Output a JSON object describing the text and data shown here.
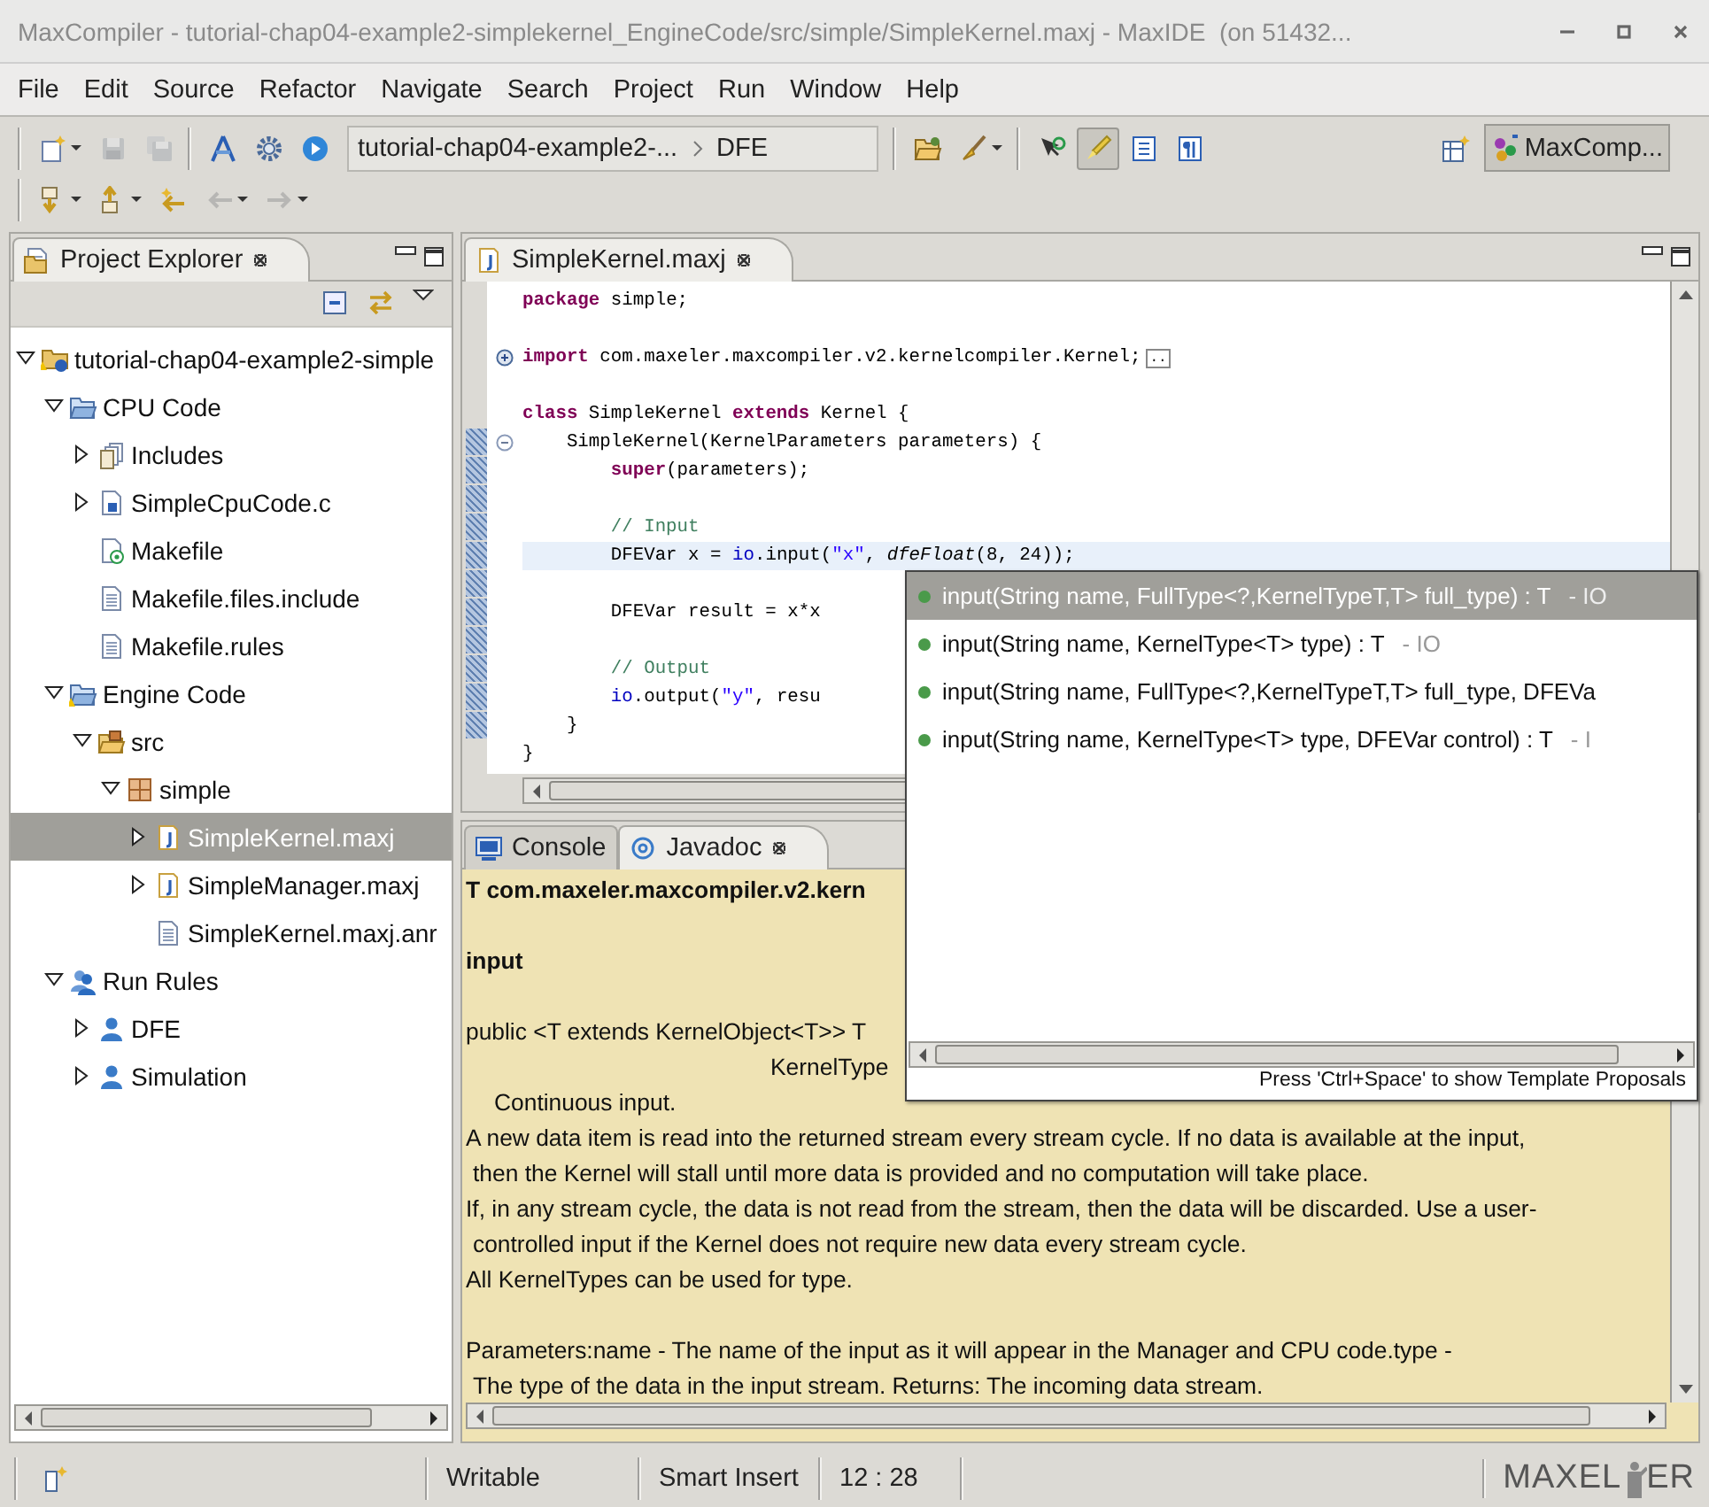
{
  "window": {
    "title": "MaxCompiler - tutorial-chap04-example2-simplekernel_EngineCode/src/simple/SimpleKernel.maxj - MaxIDE  (on 51432..."
  },
  "menu": [
    "File",
    "Edit",
    "Source",
    "Refactor",
    "Navigate",
    "Search",
    "Project",
    "Run",
    "Window",
    "Help"
  ],
  "toolbar": {
    "groups": [
      [
        {
          "kind": "new",
          "dropdown": true,
          "pressed": false,
          "disabled": false
        },
        {
          "kind": "save",
          "dropdown": false,
          "pressed": false,
          "disabled": true
        },
        {
          "kind": "save-all",
          "dropdown": false,
          "pressed": false,
          "disabled": true
        }
      ],
      [
        {
          "kind": "compass",
          "dropdown": false,
          "pressed": false,
          "disabled": false
        },
        {
          "kind": "gear",
          "dropdown": false,
          "pressed": false,
          "disabled": false
        },
        {
          "kind": "run",
          "dropdown": false,
          "pressed": false,
          "disabled": false
        }
      ]
    ],
    "breadcrumb": [
      "tutorial-chap04-example2-...",
      "DFE"
    ],
    "tool_groups": [
      [
        {
          "kind": "open-folder",
          "dropdown": false,
          "pressed": false,
          "disabled": false
        },
        {
          "kind": "brush",
          "dropdown": true,
          "pressed": false,
          "disabled": false
        }
      ],
      [
        {
          "kind": "cursor",
          "dropdown": false,
          "pressed": false,
          "disabled": false
        },
        {
          "kind": "highlighter",
          "dropdown": false,
          "pressed": true,
          "disabled": false
        },
        {
          "kind": "block",
          "dropdown": false,
          "pressed": false,
          "disabled": false
        },
        {
          "kind": "paragraph",
          "dropdown": false,
          "pressed": false,
          "disabled": false
        }
      ]
    ],
    "nav_group": [
      {
        "kind": "next-annotation",
        "dropdown": true,
        "pressed": false,
        "disabled": false
      },
      {
        "kind": "previous-annotation",
        "dropdown": true,
        "pressed": false,
        "disabled": false
      },
      {
        "kind": "last-edit",
        "dropdown": false,
        "pressed": false,
        "disabled": false
      },
      {
        "kind": "back",
        "dropdown": true,
        "pressed": false,
        "disabled": true
      },
      {
        "kind": "forward",
        "dropdown": true,
        "pressed": false,
        "disabled": true
      }
    ],
    "perspective": {
      "label": "MaxComp...",
      "selected": true
    }
  },
  "explorer": {
    "tabs": [
      {
        "label": "Project Explorer",
        "selected": true
      }
    ],
    "tree": [
      {
        "label": "tutorial-chap04-example2-simple",
        "kind": "project",
        "expanded": true,
        "selected": false,
        "children": [
          {
            "label": "CPU Code",
            "kind": "c-folder",
            "expanded": true,
            "selected": false,
            "children": [
              {
                "label": "Includes",
                "kind": "includes",
                "expanded": false,
                "selected": false
              },
              {
                "label": "SimpleCpuCode.c",
                "kind": "c-file",
                "expanded": false,
                "selected": false
              },
              {
                "label": "Makefile",
                "kind": "makefile",
                "selected": false
              },
              {
                "label": "Makefile.files.include",
                "kind": "text-file",
                "selected": false
              },
              {
                "label": "Makefile.rules",
                "kind": "text-file",
                "selected": false
              }
            ]
          },
          {
            "label": "Engine Code",
            "kind": "java-folder",
            "expanded": true,
            "selected": false,
            "children": [
              {
                "label": "src",
                "kind": "src-folder",
                "expanded": true,
                "selected": false,
                "children": [
                  {
                    "label": "simple",
                    "kind": "package",
                    "expanded": true,
                    "selected": false,
                    "children": [
                      {
                        "label": "SimpleKernel.maxj",
                        "kind": "java-file",
                        "expanded": false,
                        "selected": true
                      },
                      {
                        "label": "SimpleManager.maxj",
                        "kind": "java-file",
                        "expanded": false,
                        "selected": false
                      },
                      {
                        "label": "SimpleKernel.maxj.anr",
                        "kind": "text-file",
                        "selected": false
                      }
                    ]
                  }
                ]
              }
            ]
          },
          {
            "label": "Run Rules",
            "kind": "run-rules",
            "expanded": true,
            "selected": false,
            "children": [
              {
                "label": "DFE",
                "kind": "user",
                "expanded": false,
                "selected": false
              },
              {
                "label": "Simulation",
                "kind": "user",
                "expanded": false,
                "selected": false
              }
            ]
          }
        ]
      }
    ]
  },
  "editor": {
    "tabs": [
      {
        "label": "SimpleKernel.maxj",
        "selected": true
      }
    ],
    "lines": [
      {
        "tokens": [
          {
            "kind": "keyword",
            "text": "package"
          },
          {
            "kind": "plain",
            "text": " simple;"
          }
        ],
        "current": false,
        "changed": false
      },
      {
        "changed": false
      },
      {
        "tokens": [
          {
            "kind": "keyword",
            "text": "import"
          },
          {
            "kind": "plain",
            "text": " com.maxeler.maxcompiler.v2.kernelcompiler.Kernel;"
          },
          {
            "kind": "folded",
            "text": ".."
          }
        ],
        "collapsed": true,
        "current": false,
        "changed": false
      },
      {
        "changed": false
      },
      {
        "tokens": [
          {
            "kind": "keyword",
            "text": "class"
          },
          {
            "kind": "plain",
            "text": " SimpleKernel "
          },
          {
            "kind": "keyword",
            "text": "extends"
          },
          {
            "kind": "plain",
            "text": " Kernel {"
          }
        ],
        "current": false,
        "changed": false
      },
      {
        "tokens": [
          {
            "kind": "plain",
            "text": "    SimpleKernel(KernelParameters parameters) {"
          }
        ],
        "collapsed": false,
        "current": false,
        "changed": true
      },
      {
        "tokens": [
          {
            "kind": "keyword",
            "text": "        super"
          },
          {
            "kind": "plain",
            "text": "(parameters);"
          }
        ],
        "current": false,
        "changed": true
      },
      {
        "changed": true
      },
      {
        "tokens": [
          {
            "kind": "comment",
            "text": "        // Input"
          }
        ],
        "current": false,
        "changed": true
      },
      {
        "tokens": [
          {
            "kind": "plain",
            "text": "        DFEVar x = "
          },
          {
            "kind": "field",
            "text": "io"
          },
          {
            "kind": "plain",
            "text": ".input("
          },
          {
            "kind": "string",
            "text": "\"x\""
          },
          {
            "kind": "plain",
            "text": ", "
          },
          {
            "kind": "static",
            "text": "dfeFloat"
          },
          {
            "kind": "plain",
            "text": "(8, 24));"
          }
        ],
        "current": true,
        "changed": true
      },
      {
        "changed": true
      },
      {
        "tokens": [
          {
            "kind": "plain",
            "text": "        DFEVar result = x*x"
          }
        ],
        "current": false,
        "changed": true
      },
      {
        "changed": true
      },
      {
        "tokens": [
          {
            "kind": "comment",
            "text": "        // Output"
          }
        ],
        "current": false,
        "changed": true
      },
      {
        "tokens": [
          {
            "kind": "field",
            "text": "        io"
          },
          {
            "kind": "plain",
            "text": ".output("
          },
          {
            "kind": "string",
            "text": "\"y\""
          },
          {
            "kind": "plain",
            "text": ", resu"
          }
        ],
        "current": false,
        "changed": true
      },
      {
        "tokens": [
          {
            "kind": "plain",
            "text": "    }"
          }
        ],
        "current": false,
        "changed": true
      },
      {
        "tokens": [
          {
            "kind": "plain",
            "text": "}"
          }
        ],
        "current": false,
        "changed": false
      }
    ]
  },
  "bottom_panel": {
    "tabs": [
      {
        "label": "Console",
        "kind": "console",
        "selected": false
      },
      {
        "label": "Javadoc",
        "kind": "javadoc",
        "selected": true
      }
    ],
    "blocks": [
      {
        "lines": [
          {
            "text": "T com.maxeler.maxcompiler.v2.kern",
            "kind": "heading"
          }
        ]
      },
      {
        "lines": [
          {
            "text": "input",
            "kind": "heading"
          }
        ]
      },
      {
        "lines": [
          {
            "text": "public <T extends KernelObject<T>> T",
            "kind": "text"
          },
          {
            "text": "KernelType",
            "kind": "deep-indent"
          },
          {
            "text": "Continuous input.",
            "kind": "indent"
          },
          {
            "text": "A new data item is read into the returned stream every stream cycle. If no data is available at the input,",
            "kind": "text"
          },
          {
            "text": "then the Kernel will stall until more data is provided and no computation will take place.",
            "kind": "continued"
          },
          {
            "text": "If, in any stream cycle, the data is not read from the stream, then the data will be discarded. Use a user-",
            "kind": "text"
          },
          {
            "text": "controlled input if the Kernel does not require new data every stream cycle.",
            "kind": "continued"
          },
          {
            "text": "All KernelTypes can be used for type.",
            "kind": "text"
          }
        ]
      },
      {
        "lines": [
          {
            "text": "Parameters:name - The name of the input as it will appear in the Manager and CPU code.type -",
            "kind": "text"
          },
          {
            "text": "The type of the data in the input stream. Returns: The incoming data stream.",
            "kind": "continued"
          }
        ]
      }
    ]
  },
  "completion_popup": {
    "proposals": [
      {
        "signature": "input(String name, FullType<?,KernelTypeT,T> full_type) : T",
        "source": "- IO",
        "selected": true
      },
      {
        "signature": "input(String name, KernelType<T> type) : T",
        "source": "- IO",
        "selected": false
      },
      {
        "signature": "input(String name, FullType<?,KernelTypeT,T> full_type, DFEVa",
        "selected": false
      },
      {
        "signature": "input(String name, KernelType<T> type, DFEVar control) : T",
        "source": "- I",
        "selected": false
      }
    ],
    "hint": "Press 'Ctrl+Space' to show Template Proposals"
  },
  "status_bar": {
    "writable": "Writable",
    "insert_mode": "Smart Insert",
    "position": "12 : 28",
    "logo": {
      "before": "MAXEL",
      "after": "ER"
    }
  }
}
